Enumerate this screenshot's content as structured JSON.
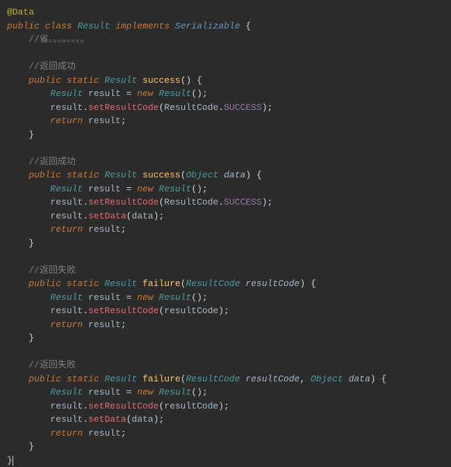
{
  "annotation": "@Data",
  "class_decl": {
    "public": "public",
    "class": "class",
    "name": "Result",
    "implements": "implements",
    "iface": "Serializable",
    "brace": "{"
  },
  "comment_head": "//省。。。。。。。。",
  "methods": [
    {
      "comment": "//返回成功",
      "mods": "public static",
      "rettype": "Result",
      "name": "success",
      "params": "",
      "body": {
        "decl_type": "Result",
        "decl_var": "result",
        "new_kw": "new",
        "ctor": "Result",
        "line2_pre": "result",
        "line2_m": "setResultCode",
        "line2_arg_pre": "ResultCode",
        "line2_arg_const": "SUCCESS",
        "has_setdata": false,
        "ret_kw": "return",
        "ret_var": "result"
      }
    },
    {
      "comment": "//返回成功",
      "mods": "public static",
      "rettype": "Result",
      "name": "success",
      "params_raw": [
        {
          "type": "Object",
          "name": "data"
        }
      ],
      "body": {
        "decl_type": "Result",
        "decl_var": "result",
        "new_kw": "new",
        "ctor": "Result",
        "line2_pre": "result",
        "line2_m": "setResultCode",
        "line2_arg_pre": "ResultCode",
        "line2_arg_const": "SUCCESS",
        "has_setdata": true,
        "setdata_pre": "result",
        "setdata_m": "setData",
        "setdata_arg": "data",
        "ret_kw": "return",
        "ret_var": "result"
      }
    },
    {
      "comment": "//返回失败",
      "mods": "public static",
      "rettype": "Result",
      "name": "failure",
      "params_raw": [
        {
          "type": "ResultCode",
          "name": "resultCode"
        }
      ],
      "body": {
        "decl_type": "Result",
        "decl_var": "result",
        "new_kw": "new",
        "ctor": "Result",
        "line2_pre": "result",
        "line2_m": "setResultCode",
        "line2_arg_plain": "resultCode",
        "has_setdata": false,
        "ret_kw": "return",
        "ret_var": "result"
      }
    },
    {
      "comment": "//返回失败",
      "mods": "public static",
      "rettype": "Result",
      "name": "failure",
      "params_raw": [
        {
          "type": "ResultCode",
          "name": "resultCode"
        },
        {
          "type": "Object",
          "name": "data"
        }
      ],
      "body": {
        "decl_type": "Result",
        "decl_var": "result",
        "new_kw": "new",
        "ctor": "Result",
        "line2_pre": "result",
        "line2_m": "setResultCode",
        "line2_arg_plain": "resultCode",
        "has_setdata": true,
        "setdata_pre": "result",
        "setdata_m": "setData",
        "setdata_arg": "data",
        "ret_kw": "return",
        "ret_var": "result"
      }
    }
  ],
  "close_brace": "}"
}
